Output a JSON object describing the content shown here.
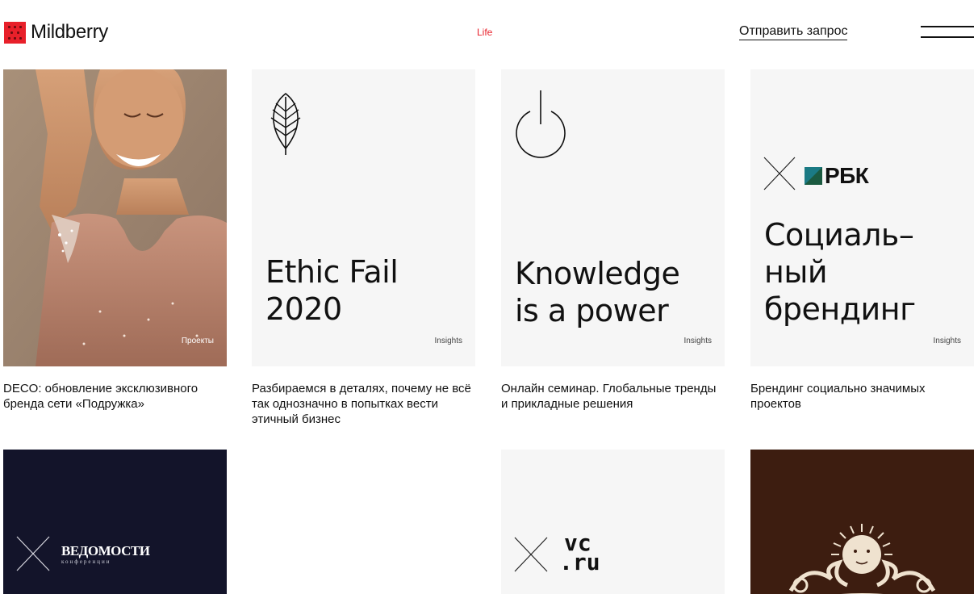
{
  "header": {
    "logo_text": "Mildberry",
    "nav_life": "Life",
    "request_link": "Отправить запрос"
  },
  "cards": [
    {
      "tag": "Проекты",
      "description": "DECO: обновление эксклюзивного бренда сети «Подружка»"
    },
    {
      "title_line1": "Ethic Fail",
      "title_line2": "2020",
      "tag": "Insights",
      "description": "Разбираемся в деталях, почему не всё так однозначно в попытках вести этичный бизнес"
    },
    {
      "title_line1": "Knowledge",
      "title_line2": "is a power",
      "tag": "Insights",
      "description": "Онлайн семинар. Глобальные тренды и прикладные решения"
    },
    {
      "partner": "РБК",
      "title_line1": "Социаль–",
      "title_line2": "ный",
      "title_line3": "брендинг",
      "tag": "Insights",
      "description": "Брендинг социально значимых проектов"
    }
  ],
  "row2": [
    {
      "partner": "ВЕДОМОСТИ",
      "partner_sub": "конференции"
    },
    {
      "partner_line1": "vc",
      "partner_line2": ".ru"
    }
  ],
  "colors": {
    "accent": "#e8202a",
    "card_bg": "#f6f6f6",
    "navy": "#13142a",
    "brown": "#3d1d10"
  }
}
